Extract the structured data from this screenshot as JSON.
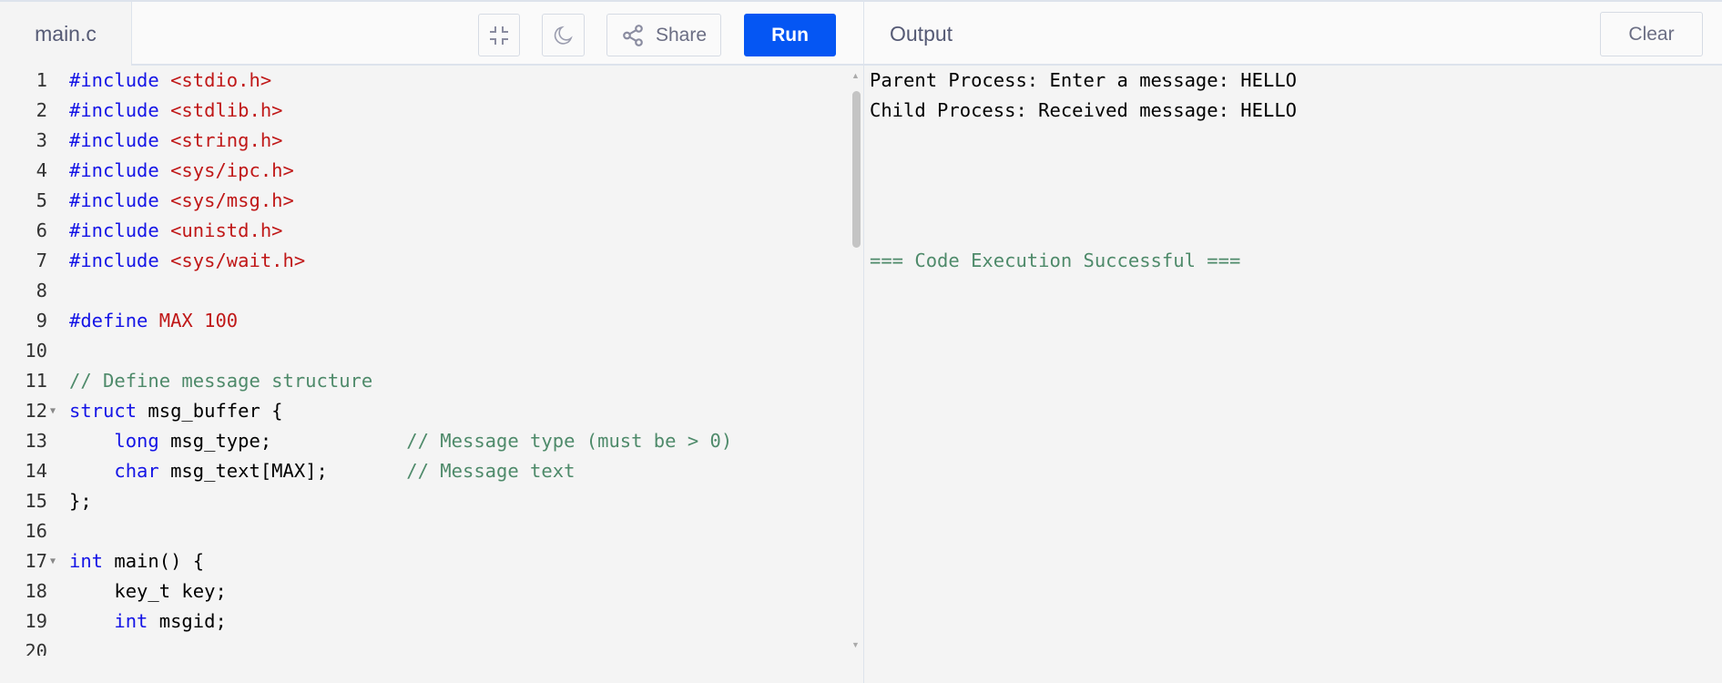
{
  "editor": {
    "file_tab": "main.c",
    "lines": [
      [
        {
          "t": "#include ",
          "c": "kw"
        },
        {
          "t": "<stdio.h>",
          "c": "str"
        }
      ],
      [
        {
          "t": "#include ",
          "c": "kw"
        },
        {
          "t": "<stdlib.h>",
          "c": "str"
        }
      ],
      [
        {
          "t": "#include ",
          "c": "kw"
        },
        {
          "t": "<string.h>",
          "c": "str"
        }
      ],
      [
        {
          "t": "#include ",
          "c": "kw"
        },
        {
          "t": "<sys/ipc.h>",
          "c": "str"
        }
      ],
      [
        {
          "t": "#include ",
          "c": "kw"
        },
        {
          "t": "<sys/msg.h>",
          "c": "str"
        }
      ],
      [
        {
          "t": "#include ",
          "c": "kw"
        },
        {
          "t": "<unistd.h>",
          "c": "str"
        }
      ],
      [
        {
          "t": "#include ",
          "c": "kw"
        },
        {
          "t": "<sys/wait.h>",
          "c": "str"
        }
      ],
      [],
      [
        {
          "t": "#define ",
          "c": "kw"
        },
        {
          "t": "MAX 100",
          "c": "num"
        }
      ],
      [],
      [
        {
          "t": "// Define message structure",
          "c": "cm"
        }
      ],
      [
        {
          "t": "struct",
          "c": "kw"
        },
        {
          "t": " msg_buffer {",
          "c": "pl"
        }
      ],
      [
        {
          "t": "    long",
          "c": "kw"
        },
        {
          "t": " msg_type;            ",
          "c": "pl"
        },
        {
          "t": "// Message type (must be > 0)",
          "c": "cm"
        }
      ],
      [
        {
          "t": "    char",
          "c": "kw"
        },
        {
          "t": " msg_text[MAX];       ",
          "c": "pl"
        },
        {
          "t": "// Message text",
          "c": "cm"
        }
      ],
      [
        {
          "t": "};",
          "c": "pl"
        }
      ],
      [],
      [
        {
          "t": "int",
          "c": "kw"
        },
        {
          "t": " main() {",
          "c": "pl"
        }
      ],
      [
        {
          "t": "    key_t key;",
          "c": "pl"
        }
      ],
      [
        {
          "t": "    int",
          "c": "kw"
        },
        {
          "t": " msgid;",
          "c": "pl"
        }
      ],
      []
    ],
    "fold_lines": [
      12,
      17
    ]
  },
  "toolbar": {
    "share_label": "Share",
    "run_label": "Run"
  },
  "output": {
    "title": "Output",
    "clear_label": "Clear",
    "lines": [
      "Parent Process: Enter a message: HELLO",
      "Child Process: Received message: HELLO",
      "",
      "",
      "",
      ""
    ],
    "success": "=== Code Execution Successful ==="
  }
}
